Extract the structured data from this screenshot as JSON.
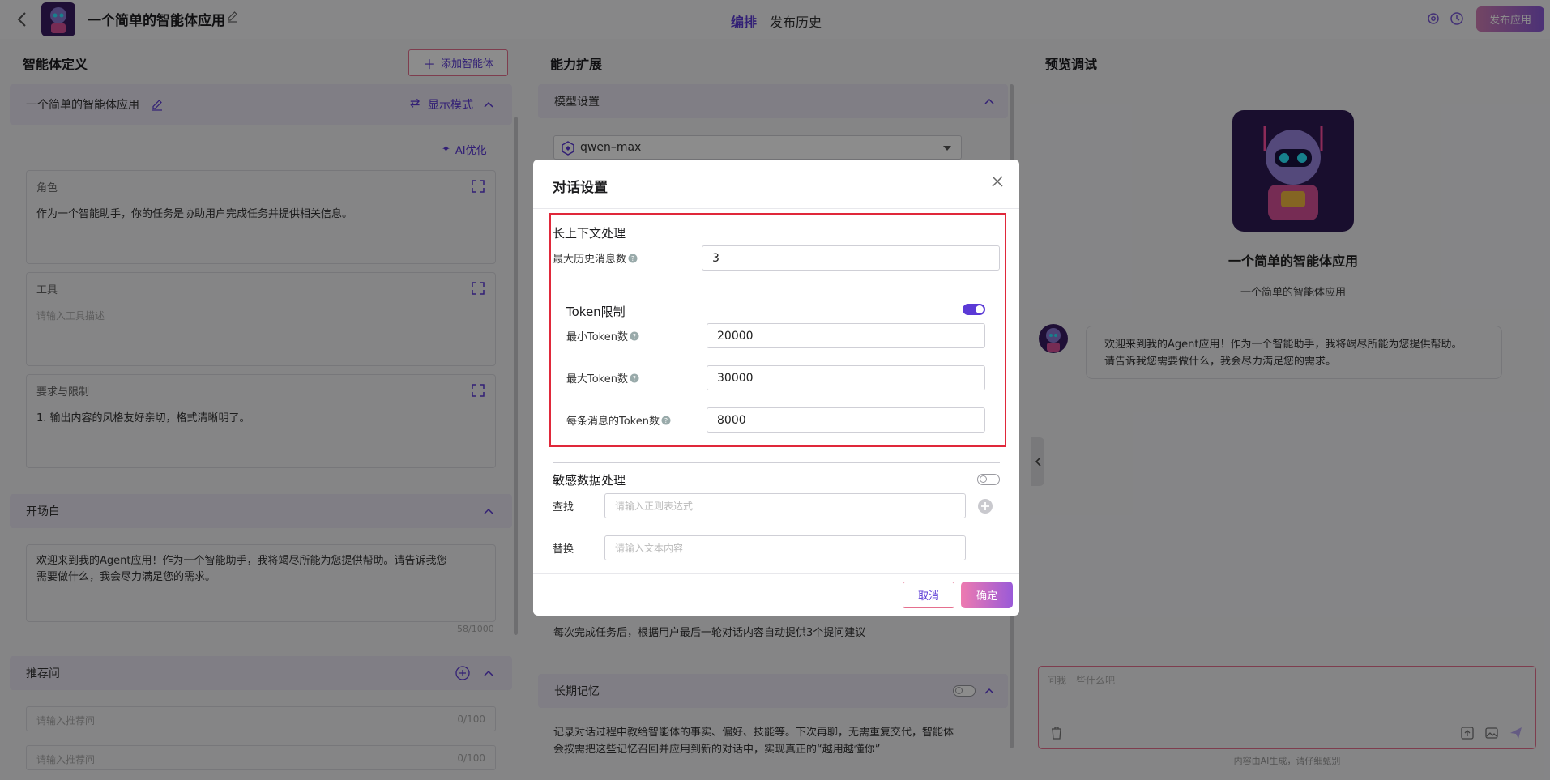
{
  "header": {
    "app_title": "一个简单的智能体应用",
    "tabs": [
      "编排",
      "发布历史"
    ],
    "publish_label": "发布应用"
  },
  "left": {
    "title": "智能体定义",
    "add_agent_label": "添加智能体",
    "agent_bar": {
      "name": "一个简单的智能体应用",
      "mode_label": "显示模式"
    },
    "ai_optimize_label": "AI优化",
    "cards": [
      {
        "label": "角色",
        "text": "作为一个智能助手，你的任务是协助用户完成任务并提供相关信息。",
        "placeholder": ""
      },
      {
        "label": "工具",
        "text": "",
        "placeholder": "请输入工具描述"
      },
      {
        "label": "要求与限制",
        "text": "1. 输出内容的风格友好亲切，格式清晰明了。",
        "placeholder": ""
      }
    ],
    "opening": {
      "title": "开场白",
      "text_line1": "欢迎来到我的Agent应用！作为一个智能助手，我将竭尽所能为您提供帮助。请告诉我您",
      "text_line2": "需要做什么，我会尽力满足您的需求。",
      "count": "58/1000"
    },
    "recommend": {
      "title": "推荐问",
      "items": [
        {
          "placeholder": "请输入推荐问",
          "count": "0/100"
        },
        {
          "placeholder": "请输入推荐问",
          "count": "0/100"
        }
      ]
    }
  },
  "mid": {
    "title": "能力扩展",
    "model_section": "模型设置",
    "model_name": "qwen–max",
    "suggest_text": "每次完成任务后，根据用户最后一轮对话内容自动提供3个提问建议",
    "memory": {
      "title": "长期记忆",
      "desc_line1": "记录对话过程中教给智能体的事实、偏好、技能等。下次再聊，无需重复交代，智能体",
      "desc_line2": "会按需把这些记忆召回并应用到新的对话中，实现真正的“越用越懂你”"
    }
  },
  "right": {
    "title": "预览调试",
    "app_name": "一个简单的智能体应用",
    "app_desc": "一个简单的智能体应用",
    "greeting_line1": "欢迎来到我的Agent应用！作为一个智能助手，我将竭尽所能为您提供帮助。",
    "greeting_line2": "请告诉我您需要做什么，我会尽力满足您的需求。",
    "input_placeholder": "问我一些什么吧",
    "disclaimer": "内容由AI生成，请仔细甄别"
  },
  "modal": {
    "title": "对话设置",
    "long_context": {
      "title": "长上下文处理",
      "max_history_label": "最大历史消息数",
      "max_history_value": "3"
    },
    "token_limit": {
      "title": "Token限制",
      "enabled": true,
      "min_label": "最小Token数",
      "min_value": "20000",
      "max_label": "最大Token数",
      "max_value": "30000",
      "per_msg_label": "每条消息的Token数",
      "per_msg_value": "8000"
    },
    "sensitive": {
      "title": "敏感数据处理",
      "enabled": false,
      "find_label": "查找",
      "find_placeholder": "请输入正则表达式",
      "replace_label": "替换",
      "replace_placeholder": "请输入文本内容"
    },
    "cancel_label": "取消",
    "ok_label": "确定"
  },
  "colors": {
    "accent": "#5b3ad6",
    "highlight": "#e0283a",
    "pink": "#e56f8e"
  }
}
